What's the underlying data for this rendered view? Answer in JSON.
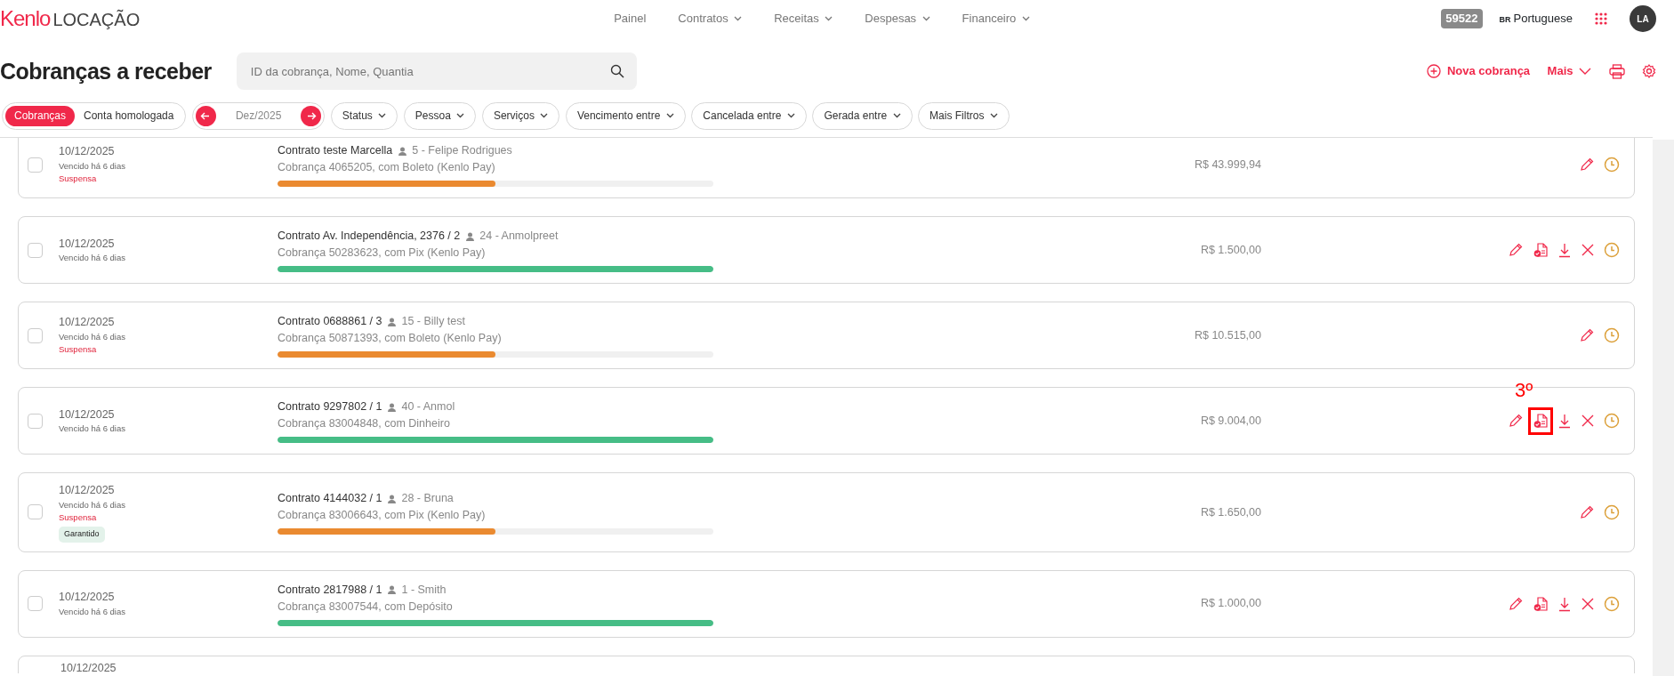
{
  "header": {
    "logo": {
      "brand": "Kenlo",
      "product": "LOCAÇÃO"
    },
    "nav": [
      {
        "label": "Painel",
        "dropdown": false
      },
      {
        "label": "Contratos",
        "dropdown": true
      },
      {
        "label": "Receitas",
        "dropdown": true
      },
      {
        "label": "Despesas",
        "dropdown": true
      },
      {
        "label": "Financeiro",
        "dropdown": true
      }
    ],
    "account_number": "59522",
    "language": {
      "code": "BR",
      "label": "Portuguese"
    },
    "avatar": "LA"
  },
  "page": {
    "title": "Cobranças a receber",
    "search": {
      "placeholder": "ID da cobrança, Nome, Quantia"
    },
    "actions": [
      {
        "kind": "new",
        "label": "Nova cobrança"
      },
      {
        "kind": "more",
        "label": "Mais"
      },
      {
        "kind": "print"
      },
      {
        "kind": "settings"
      }
    ]
  },
  "filters": {
    "view_toggle": [
      {
        "label": "Cobranças",
        "selected": true
      },
      {
        "label": "Conta homologada",
        "selected": false
      }
    ],
    "month": "Dez/2025",
    "dropdowns": [
      "Status",
      "Pessoa",
      "Serviços",
      "Vencimento entre",
      "Cancelada entre",
      "Gerada entre",
      "Mais Filtros"
    ]
  },
  "rows": [
    {
      "date": "10/12/2025",
      "due": "Vencido há 6 dias",
      "status": "Suspensa",
      "contract": "Contrato teste Marcella",
      "person": "5 - Felipe Rodrigues",
      "charge": "Cobrança 4065205, com Boleto (Kenlo Pay)",
      "bar": {
        "level": 0.5,
        "color": "#ea8a30"
      },
      "amount": "R$ 43.999,94",
      "checked": false,
      "actions": [
        {
          "kind": "edit"
        },
        {
          "kind": "history"
        }
      ]
    },
    {
      "date": "10/12/2025",
      "due": "Vencido há 6 dias",
      "contract": "Contrato Av. Independência, 2376 / 2",
      "person": "24 - Anmolpreet",
      "charge": "Cobrança 50283623, com Pix (Kenlo Pay)",
      "bar": {
        "level": 1,
        "color": "#46bd86"
      },
      "amount": "R$ 1.500,00",
      "checked": false,
      "actions": [
        {
          "kind": "edit"
        },
        {
          "kind": "receipt"
        },
        {
          "kind": "download"
        },
        {
          "kind": "cancel"
        },
        {
          "kind": "history"
        }
      ]
    },
    {
      "date": "10/12/2025",
      "due": "Vencido há 6 dias",
      "status": "Suspensa",
      "contract": "Contrato 0688861 / 3",
      "person": "15 - Billy test",
      "charge": "Cobrança 50871393, com Boleto (Kenlo Pay)",
      "bar": {
        "level": 0.5,
        "color": "#ea8a30"
      },
      "amount": "R$ 10.515,00",
      "checked": false,
      "actions": [
        {
          "kind": "edit"
        },
        {
          "kind": "history"
        }
      ]
    },
    {
      "date": "10/12/2025",
      "due": "Vencido há 6 dias",
      "contract": "Contrato 9297802 / 1",
      "person": "40 - Anmol",
      "charge": "Cobrança 83004848, com Dinheiro",
      "bar": {
        "level": 1,
        "color": "#46bd86"
      },
      "amount": "R$ 9.004,00",
      "checked": false,
      "actions": [
        {
          "kind": "edit"
        },
        {
          "kind": "receipt",
          "annotation": "3º"
        },
        {
          "kind": "download"
        },
        {
          "kind": "cancel"
        },
        {
          "kind": "history"
        }
      ]
    },
    {
      "date": "10/12/2025",
      "due": "Vencido há 6 dias",
      "status": "Suspensa",
      "tag": "Garantido",
      "contract": "Contrato 4144032 / 1",
      "person": "28 - Bruna",
      "charge": "Cobrança 83006643, com Pix (Kenlo Pay)",
      "bar": {
        "level": 0.5,
        "color": "#ea8a30"
      },
      "amount": "R$ 1.650,00",
      "checked": false,
      "actions": [
        {
          "kind": "edit"
        },
        {
          "kind": "history"
        }
      ]
    },
    {
      "date": "10/12/2025",
      "due": "Vencido há 6 dias",
      "contract": "Contrato 2817988 / 1",
      "person": "1 - Smith",
      "charge": "Cobrança 83007544, com Depósito",
      "bar": {
        "level": 1,
        "color": "#46bd86"
      },
      "amount": "R$ 1.000,00",
      "checked": false,
      "actions": [
        {
          "kind": "edit"
        },
        {
          "kind": "receipt"
        },
        {
          "kind": "download"
        },
        {
          "kind": "cancel"
        },
        {
          "kind": "history"
        }
      ]
    },
    {
      "kind": "cut_off",
      "date": "10/12/2025"
    }
  ]
}
